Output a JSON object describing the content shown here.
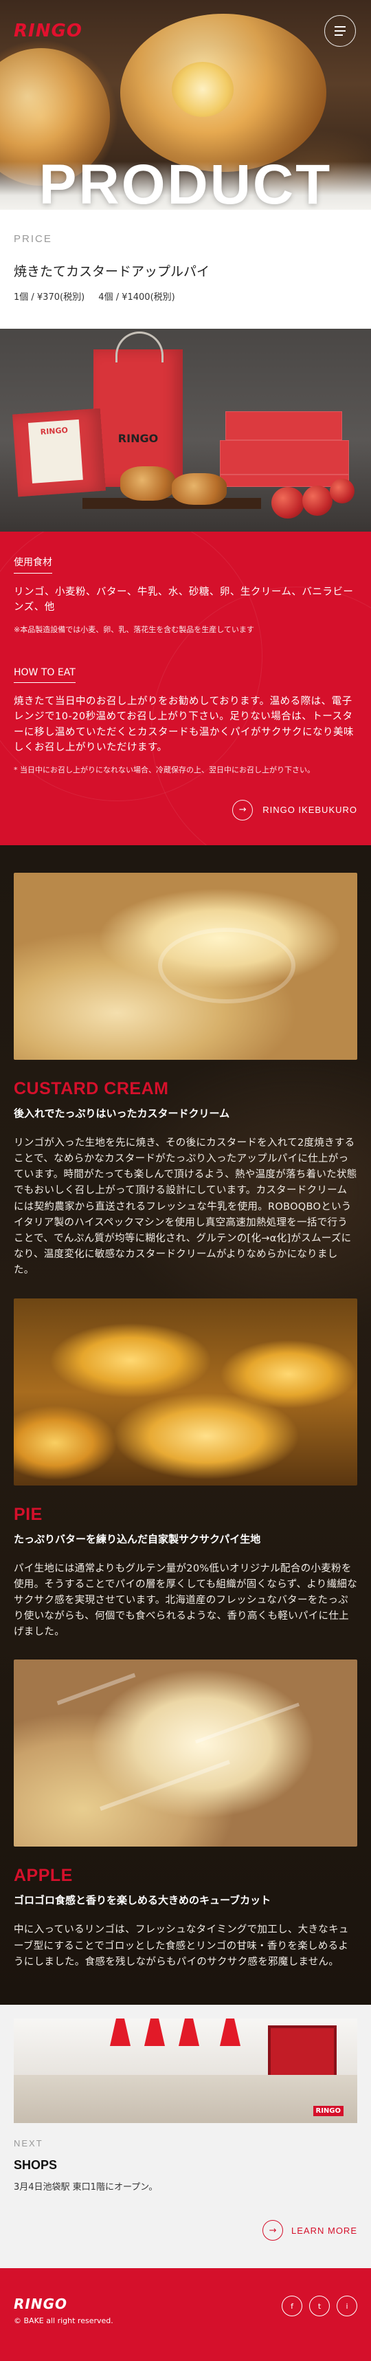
{
  "header": {
    "logo": "RINGO",
    "title": "PRODUCT"
  },
  "price": {
    "label": "PRICE",
    "name": "焼きたてカスタードアップルパイ",
    "single": "1個 / ¥370(税別)",
    "four": "4個 / ¥1400(税別)"
  },
  "products_photo": {
    "bag_logo": "RINGO",
    "small_bag_logo": "RINGO"
  },
  "ingredients": {
    "title": "使用食材",
    "text": "リンゴ、小麦粉、バター、牛乳、水、砂糖、卵、生クリーム、バニラビーンズ、他",
    "note": "※本品製造設備では小麦、卵、乳、落花生を含む製品を生産しています"
  },
  "howto": {
    "title": "HOW TO EAT",
    "text": "焼きたて当日中のお召し上がりをお勧めしております。温める際は、電子レンジで10-20秒温めてお召し上がり下さい。足りない場合は、トースターに移し温めていただくとカスタードも温かくパイがサクサクになり美味しくお召し上がりいただけます。",
    "note": "* 当日中にお召し上がりになれない場合、冷蔵保存の上、翌日中にお召し上がり下さい。"
  },
  "shop_link": {
    "label": "RINGO IKEBUKURO",
    "icon": "arrow-right-icon"
  },
  "sections": [
    {
      "title": "CUSTARD CREAM",
      "subtitle": "後入れでたっぷりはいったカスタードクリーム",
      "body": "リンゴが入った生地を先に焼き、その後にカスタードを入れて2度焼きすることで、なめらかなカスタードがたっぷり入ったアップルパイに仕上がっています。時間がたっても楽しんで頂けるよう、熱や温度が落ち着いた状態でもおいしく召し上がって頂ける設計にしています。カスタードクリームには契約農家から直送されるフレッシュな牛乳を使用。ROBOQBOというイタリア製のハイスペックマシンを使用し真空高速加熱処理を一括で行うことで、でんぷん質が均等に糊化され、グルテンの[化→α化]がスムーズになり、温度変化に敏感なカスタードクリームがよりなめらかになりました。"
    },
    {
      "title": "PIE",
      "subtitle": "たっぷりバターを練り込んだ自家製サクサクパイ生地",
      "body": "パイ生地には通常よりもグルテン量が20%低いオリジナル配合の小麦粉を使用。そうすることでパイの層を厚くしても組織が固くならず、より繊細なサクサク感を実現させています。北海道産のフレッシュなバターをたっぷり使いながらも、何個でも食べられるような、香り高くも軽いパイに仕上げました。"
    },
    {
      "title": "APPLE",
      "subtitle": "ゴロゴロ食感と香りを楽しめる大きめのキューブカット",
      "body": "中に入っているリンゴは、フレッシュなタイミングで加工し、大きなキューブ型にすることでゴロッとした食感とリンゴの甘味・香りを楽しめるようにしました。食感を残しながらもパイのサクサク感を邪魔しません。"
    }
  ],
  "next": {
    "label": "NEXT",
    "title": "SHOPS",
    "desc": "3月4日池袋駅 東口1階にオープン。",
    "learn_more": "LEARN MORE",
    "shop_sign": "RINGO"
  },
  "footer": {
    "logo": "RINGO",
    "copyright": "© BAKE all right reserved.",
    "socials": [
      "f",
      "t",
      "i"
    ]
  },
  "colors": {
    "brand_red": "#d5102b",
    "dark_bg": "#1e1710"
  }
}
